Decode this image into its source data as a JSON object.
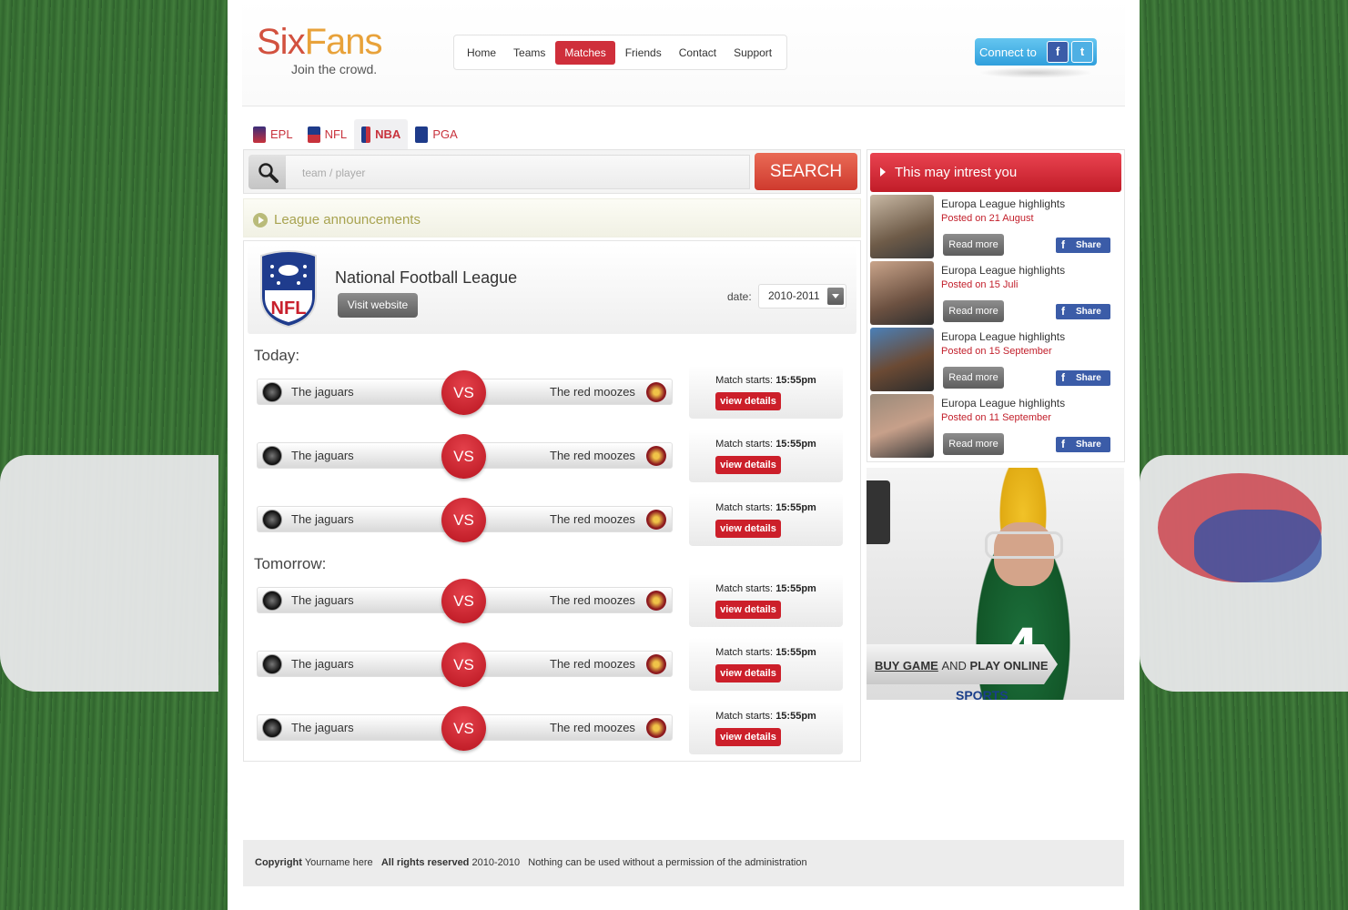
{
  "brand": {
    "name_part1": "Six",
    "name_part2": "Fans",
    "tagline": "Join the crowd."
  },
  "nav": {
    "items": [
      "Home",
      "Teams",
      "Matches",
      "Friends",
      "Contact",
      "Support"
    ],
    "active": "Matches"
  },
  "connect": {
    "label": "Connect to",
    "facebook_icon": "f",
    "twitter_icon": "t"
  },
  "league_tabs": [
    {
      "label": "EPL",
      "icon": "epl-icon",
      "active": false
    },
    {
      "label": "NFL",
      "icon": "nfl-icon",
      "active": false
    },
    {
      "label": "NBA",
      "icon": "nba-icon",
      "active": true
    },
    {
      "label": "PGA",
      "icon": "pga-icon",
      "active": false
    }
  ],
  "search": {
    "placeholder": "team / player",
    "button": "SEARCH"
  },
  "announcements": {
    "label": "League announcements"
  },
  "league": {
    "title": "National Football League",
    "visit_button": "Visit website",
    "date_label": "date:",
    "date_value": "2010-2011"
  },
  "sections": {
    "today": "Today:",
    "tomorrow": "Tomorrow:"
  },
  "matches": [
    {
      "home": "The jaguars",
      "away": "The red moozes",
      "vs": "VS",
      "starts_label": "Match starts:",
      "time": "15:55pm",
      "details": "view details"
    },
    {
      "home": "The jaguars",
      "away": "The red moozes",
      "vs": "VS",
      "starts_label": "Match starts:",
      "time": "15:55pm",
      "details": "view details"
    },
    {
      "home": "The jaguars",
      "away": "The red moozes",
      "vs": "VS",
      "starts_label": "Match starts:",
      "time": "15:55pm",
      "details": "view details"
    },
    {
      "home": "The jaguars",
      "away": "The red moozes",
      "vs": "VS",
      "starts_label": "Match starts:",
      "time": "15:55pm",
      "details": "view details"
    },
    {
      "home": "The jaguars",
      "away": "The red moozes",
      "vs": "VS",
      "starts_label": "Match starts:",
      "time": "15:55pm",
      "details": "view details"
    },
    {
      "home": "The jaguars",
      "away": "The red moozes",
      "vs": "VS",
      "starts_label": "Match starts:",
      "time": "15:55pm",
      "details": "view details"
    }
  ],
  "sidebar": {
    "title": "This may intrest you",
    "news": [
      {
        "title": "Europa League highlights",
        "date": "Posted on 21 August",
        "read": "Read more",
        "share": "Share"
      },
      {
        "title": "Europa League highlights",
        "date": "Posted on 15 Juli",
        "read": "Read more",
        "share": "Share"
      },
      {
        "title": "Europa League highlights",
        "date": "Posted on 15 September",
        "read": "Read more",
        "share": "Share"
      },
      {
        "title": "Europa League highlights",
        "date": "Posted on 11 September",
        "read": "Read more",
        "share": "Share"
      }
    ]
  },
  "ad": {
    "buy": "BUY GAME",
    "and": "AND",
    "play": "PLAY ONLINE",
    "brand_text": "SPORTS",
    "jersey_number": "4"
  },
  "footer": {
    "copyright_label": "Copyright",
    "owner": "Yourname here",
    "rights_label": "All rights reserved",
    "years": "2010-2010",
    "notice": "Nothing can be used without a permission of the administration"
  },
  "colors": {
    "accent_red": "#cf2f3b",
    "brand_orange": "#e8a23a",
    "brand_red": "#d2513f",
    "facebook_blue": "#3b5ca8"
  }
}
